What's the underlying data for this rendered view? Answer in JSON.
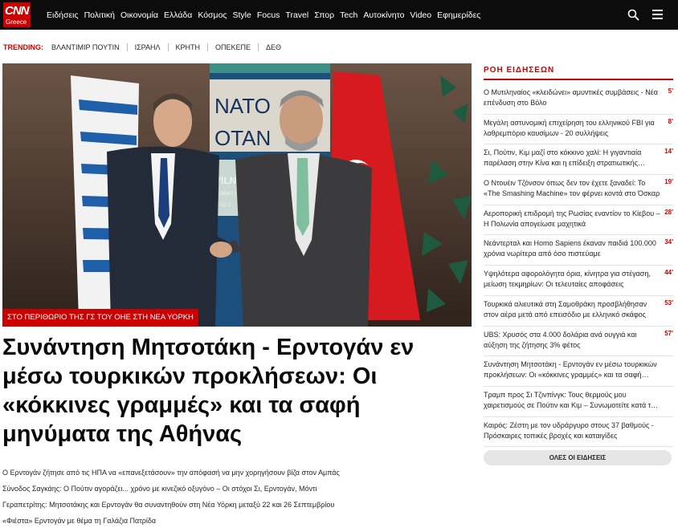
{
  "brand": {
    "logo_text": "CNN",
    "logo_sub": "Greece"
  },
  "nav": {
    "items": [
      "Ειδήσεις",
      "Πολιτική",
      "Οικονομία",
      "Ελλάδα",
      "Κόσμος",
      "Style",
      "Focus",
      "Travel",
      "Σπορ",
      "Tech",
      "Αυτοκίνητο",
      "Video",
      "Εφημερίδες"
    ]
  },
  "trending": {
    "label": "TRENDING:",
    "items": [
      "ΒΛΑΝΤΙΜΙΡ ΠΟΥΤΙΝ",
      "ΙΣΡΑΗΛ",
      "ΚΡΗΤΗ",
      "ΟΠΕΚΕΠΕ",
      "ΔΕΘ"
    ]
  },
  "hero": {
    "caption": "ΣΤΟ ΠΕΡΙΘΩΡΙΟ ΤΗΣ ΓΣ ΤΟΥ ΟΗΕ ΣΤΗ ΝΕΑ ΥΟΡΚΗ",
    "headline": "Συνάντηση Μητσοτάκη - Ερντογάν εν μέσω τουρκικών προκλήσεων: Οι «κόκκινες γραμμές» και τα σαφή μηνύματα της Αθήνας",
    "backdrop": {
      "nato": "NATO",
      "otan": "OTAN",
      "vilnius": "VILNI",
      "summit": "SUMMIT |",
      "dates": "11-12 V"
    }
  },
  "related": [
    "Ο Ερντογάν ζήτησε από τις ΗΠΑ να «επανεξετάσουν» την απόφασή να μην χορηγήσουν βίζα στον Αμπάς",
    "Σύνοδος Σαγκάης: Ο Πούτιν αγοράζει... χρόνο με κινεζικό οξυγόνο – Οι στόχοι Σι, Ερντογάν, Μόντι",
    "Γεραπετρίτης: Μητσοτάκης και Ερντογάν θα συναντηθούν στη Νέα Υόρκη μεταξύ 22 και 26 Σεπτεμβρίου",
    "«Φιέστα» Ερντογάν με θέμα τη Γαλάζια Πατρίδα"
  ],
  "ticker": {
    "title": "ΡΟΗ ΕΙΔΗΣΕΩΝ",
    "items": [
      {
        "text": "Ο Μυτιληναίος «κλειδώνει» αμυντικές συμβάσεις - Νέα επένδυση στο Βόλο",
        "time": "5'"
      },
      {
        "text": "Μεγάλη αστυνομική επιχείρηση του ελληνικού FBI για λαθρεμπόριο καυσίμων - 20 συλλήψεις",
        "time": "8'"
      },
      {
        "text": "Σι, Πούτιν, Κιμ μαζί στο κόκκινο χαλί: Η γιγαντιαία παρέλαση στην Κίνα και η επίδειξη στρατιωτικής ισχύος",
        "time": "14'"
      },
      {
        "text": "Ο Ντουέιν Τζόνσον όπως δεν τον έχετε ξαναδεί: Το «The Smashing Machine» τον φέρνει κοντά στο Όσκαρ",
        "time": "19'"
      },
      {
        "text": "Αεροπορική επιδρομή της Ρωσίας εναντίον το Κίεβου – Η Πολωνία απογείωσε μαχητικά",
        "time": "28'"
      },
      {
        "text": "Νεάντερταλ και Homo Sapiens έκαναν παιδιά 100.000 χρόνια νωρίτερα από όσο πιστεύαμε",
        "time": "34'"
      },
      {
        "text": "Υψηλότερα αφορολόγητα όρια, κίνητρα για στέγαση, μείωση τεκμηρίων: Οι τελευταίες αποφάσεις",
        "time": "44'"
      },
      {
        "text": "Τουρκικά αλιευτικά στη Σαμοθράκη προσβλήθησαν στον αέρα μετά από επεισόδιο με ελληνικό σκάφος",
        "time": "53'"
      },
      {
        "text": "UBS: Χρυσός στα 4.000 δολάρια ανά ουγγιά και αύξηση της ζήτησης 3% φέτος",
        "time": "57'"
      },
      {
        "text": "Συνάντηση Μητσοτάκη - Ερντογάν εν μέσω τουρκικών προκλήσεων: Οι «κόκκινες γραμμές» και τα σαφή μηνύματα",
        "time": ""
      },
      {
        "text": "Τραμπ προς Σι Τζινπίνγκ: Τους θερμούς μου χαιρετισμούς σε Πούτιν και Κιμ – Συνωμοτείτε κατά των ΗΠΑ",
        "time": ""
      },
      {
        "text": "Καιρός: Ζέστη με τον υδράργυρο στους 37 βαθμούς - Πρόσκαιρες τοπικές βροχές και καταιγίδες",
        "time": ""
      }
    ],
    "all_label": "ΟΛΕΣ ΟΙ ΕΙΔΗΣΕΙΣ"
  }
}
